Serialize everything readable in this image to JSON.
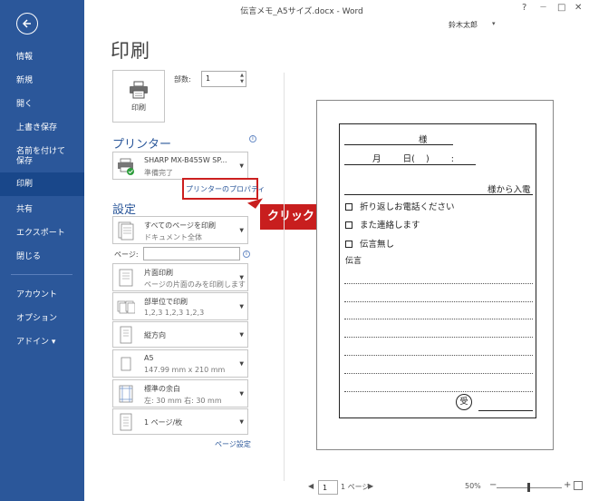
{
  "titlebar": {
    "title": "伝言メモ_A5サイズ.docx - Word",
    "help": "?",
    "minimize": "—",
    "restore": "□",
    "close": "✕",
    "user": "鈴木太郎",
    "user_caret": "▾"
  },
  "sidebar": {
    "back_icon": "back-arrow-icon",
    "items": [
      {
        "label": "情報"
      },
      {
        "label": "新規"
      },
      {
        "label": "開く"
      },
      {
        "label": "上書き保存"
      },
      {
        "label": "名前を付けて\n保存"
      },
      {
        "label": "印刷"
      },
      {
        "label": "共有"
      },
      {
        "label": "エクスポート"
      },
      {
        "label": "閉じる"
      },
      {
        "label": "アカウント"
      },
      {
        "label": "オプション"
      },
      {
        "label": "アドイン ▾"
      }
    ]
  },
  "main": {
    "page_title": "印刷",
    "print_button": "印刷",
    "copies_label": "部数:",
    "copies_value": "1",
    "printer_heading": "プリンター",
    "printer_name": "SHARP MX-B455W SP...",
    "printer_status": "準備完了",
    "printer_properties": "プリンターのプロパティ",
    "callout": "クリック",
    "settings_heading": "設定",
    "settings": [
      {
        "line1": "すべてのページを印刷",
        "line2": "ドキュメント全体"
      },
      {
        "line1": "片面印刷",
        "line2": "ページの片面のみを印刷します"
      },
      {
        "line1": "部単位で印刷",
        "line2": "1,2,3    1,2,3    1,2,3"
      },
      {
        "line1": "縦方向",
        "line2": ""
      },
      {
        "line1": "A5",
        "line2": "147.99 mm x 210 mm"
      },
      {
        "line1": "標準の余白",
        "line2": "左:  30 mm    右:  30 mm"
      },
      {
        "line1": "1 ページ/枚",
        "line2": ""
      }
    ],
    "pages_label": "ページ:",
    "page_setup_link": "ページ設定"
  },
  "preview": {
    "sama": "様",
    "datetime": "月        日(    )        :",
    "call_from": "様から入電",
    "checks": [
      "折り返しお電話ください",
      "また連絡します",
      "伝言無し"
    ],
    "message_label": "伝言",
    "seal": "㊫"
  },
  "status": {
    "page_current": "1",
    "page_total": "1 ページ",
    "zoom": "50%",
    "zoom_level_percent": 50
  },
  "colors": {
    "accent": "#2b579a",
    "highlight": "#c81e1e"
  }
}
